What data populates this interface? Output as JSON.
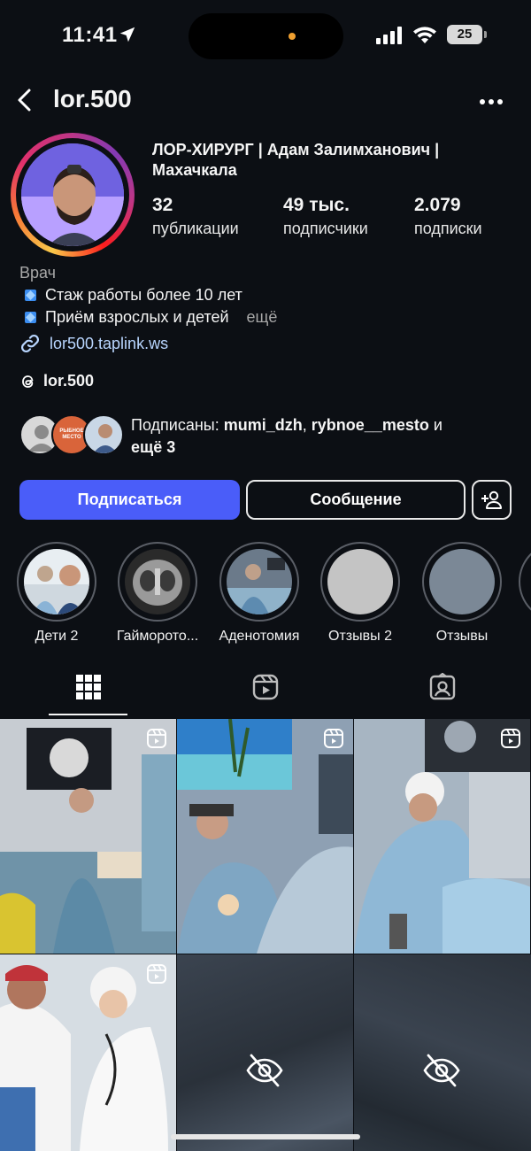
{
  "status_bar": {
    "time": "11:41",
    "battery": "25"
  },
  "header": {
    "username": "lor.500"
  },
  "profile": {
    "display_name": "ЛОР-ХИРУРГ | Адам Залимханович | Махачкала",
    "stats": [
      {
        "value": "32",
        "label": "публикации"
      },
      {
        "value": "49 тыс.",
        "label": "подписчики"
      },
      {
        "value": "2.079",
        "label": "подписки"
      }
    ],
    "category": "Врач",
    "bio_lines": [
      "Стаж работы более 10 лет",
      "Приём взрослых и детей"
    ],
    "bio_more": "ещё",
    "link": "lor500.taplink.ws",
    "threads": "lor.500",
    "followed_by": {
      "prefix": "Подписаны: ",
      "user1": "mumi_dzh",
      "sep": ", ",
      "user2": "rybnoe__mesto",
      "and": " и",
      "more": "ещё 3",
      "mutual_badge_text": "РЫБНОЕ МЕСТО"
    }
  },
  "actions": {
    "follow": "Подписаться",
    "message": "Сообщение"
  },
  "highlights": [
    {
      "label": "Дети 2"
    },
    {
      "label": "Гайморото..."
    },
    {
      "label": "Аденотомия"
    },
    {
      "label": "Отзывы 2"
    },
    {
      "label": "Отзывы"
    }
  ],
  "tabs": [
    "grid-icon",
    "reels-icon",
    "tagged-icon"
  ],
  "colors": {
    "accent": "#4a5df9",
    "background": "#0c0f14",
    "link": "#b9d6ff"
  }
}
